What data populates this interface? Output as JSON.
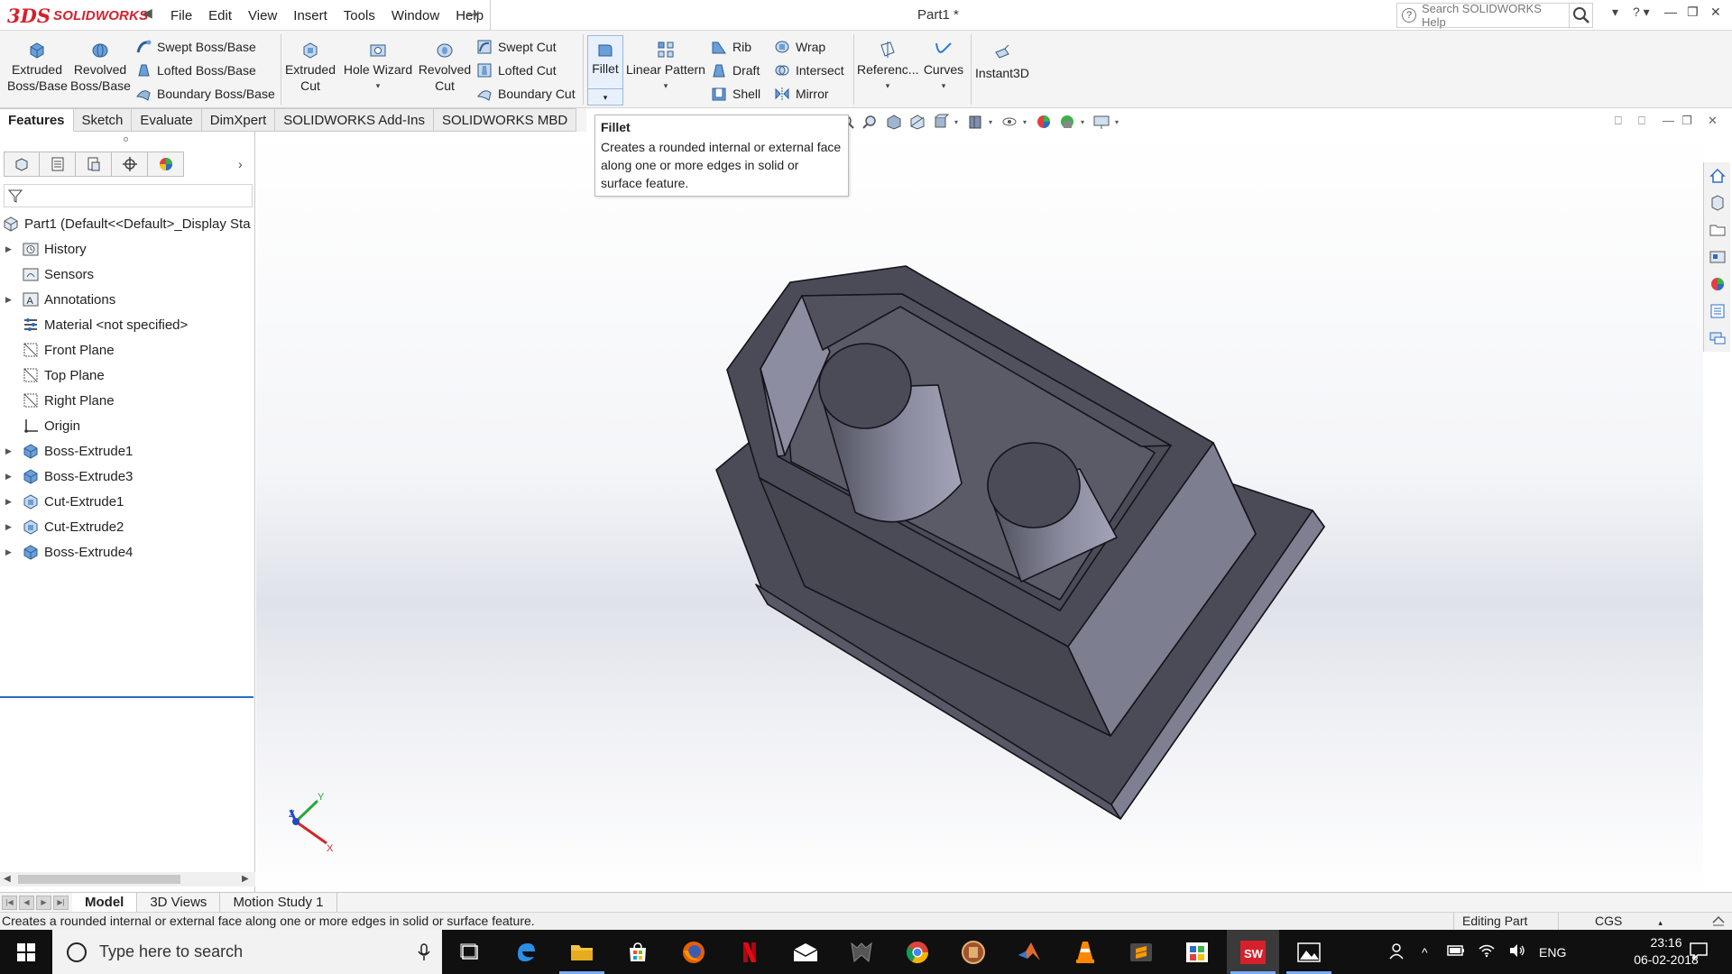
{
  "app": {
    "logo_mark": "3DS",
    "logo_text": "SOLIDWORKS",
    "document_title": "Part1 *",
    "help_search_placeholder": "Search SOLIDWORKS Help",
    "help_glyph": "?"
  },
  "menu": [
    "File",
    "Edit",
    "View",
    "Insert",
    "Tools",
    "Window",
    "Help"
  ],
  "commands": {
    "extruded_boss": [
      "Extruded",
      "Boss/Base"
    ],
    "revolved_boss": [
      "Revolved",
      "Boss/Base"
    ],
    "swept_boss": "Swept Boss/Base",
    "lofted_boss": "Lofted Boss/Base",
    "boundary_boss": "Boundary Boss/Base",
    "extruded_cut": [
      "Extruded",
      "Cut"
    ],
    "hole_wizard": "Hole Wizard",
    "revolved_cut": [
      "Revolved",
      "Cut"
    ],
    "swept_cut": "Swept Cut",
    "lofted_cut": "Lofted Cut",
    "boundary_cut": "Boundary Cut",
    "fillet": "Fillet",
    "linear_pattern": "Linear Pattern",
    "rib": "Rib",
    "draft": "Draft",
    "shell": "Shell",
    "wrap": "Wrap",
    "intersect": "Intersect",
    "mirror": "Mirror",
    "reference": "Referenc...",
    "curves": "Curves",
    "instant3d": "Instant3D"
  },
  "tabs": [
    "Features",
    "Sketch",
    "Evaluate",
    "DimXpert",
    "SOLIDWORKS Add-Ins",
    "SOLIDWORKS MBD"
  ],
  "active_tab": "Features",
  "tooltip": {
    "title": "Fillet",
    "body": "Creates a rounded internal or external face along one or more edges in solid or surface feature."
  },
  "feature_tree": {
    "root": "Part1  (Default<<Default>_Display Sta",
    "items": [
      {
        "label": "History",
        "icon": "history-folder-icon",
        "expandable": true
      },
      {
        "label": "Sensors",
        "icon": "sensors-folder-icon",
        "expandable": false
      },
      {
        "label": "Annotations",
        "icon": "annotations-icon",
        "expandable": true
      },
      {
        "label": "Material <not specified>",
        "icon": "material-icon",
        "expandable": false
      },
      {
        "label": "Front Plane",
        "icon": "plane-icon",
        "expandable": false
      },
      {
        "label": "Top Plane",
        "icon": "plane-icon",
        "expandable": false
      },
      {
        "label": "Right Plane",
        "icon": "plane-icon",
        "expandable": false
      },
      {
        "label": "Origin",
        "icon": "origin-icon",
        "expandable": false
      },
      {
        "label": "Boss-Extrude1",
        "icon": "boss-extrude-icon",
        "expandable": true
      },
      {
        "label": "Boss-Extrude3",
        "icon": "boss-extrude-icon",
        "expandable": true
      },
      {
        "label": "Cut-Extrude1",
        "icon": "cut-extrude-icon",
        "expandable": true
      },
      {
        "label": "Cut-Extrude2",
        "icon": "cut-extrude-icon",
        "expandable": true
      },
      {
        "label": "Boss-Extrude4",
        "icon": "boss-extrude-icon",
        "expandable": true
      }
    ]
  },
  "triad": {
    "x": "X",
    "y": "Y",
    "z": "Z"
  },
  "bottom_tabs": [
    "Model",
    "3D Views",
    "Motion Study 1"
  ],
  "active_bottom_tab": "Model",
  "status": {
    "message": "Creates a rounded internal or external face along one or more edges in solid or surface feature.",
    "mode": "Editing Part",
    "units": "CGS"
  },
  "taskbar": {
    "search_placeholder": "Type here to search",
    "apps": [
      "task-view-icon",
      "edge-icon",
      "file-explorer-icon",
      "store-icon",
      "firefox-icon",
      "netflix-icon",
      "mail-icon",
      "predator-icon",
      "chrome-icon",
      "app-icon",
      "matlab-icon",
      "vlc-icon",
      "sublime-icon",
      "photos-app-icon",
      "solidworks-icon",
      "photos-icon"
    ],
    "language": "ENG",
    "time": "23:16",
    "date": "06-02-2018"
  },
  "colors": {
    "brand_red": "#d6202c",
    "model_dark": "#4a4b57",
    "model_light": "#7e7f91",
    "selection_blue": "#2b6cc4"
  }
}
